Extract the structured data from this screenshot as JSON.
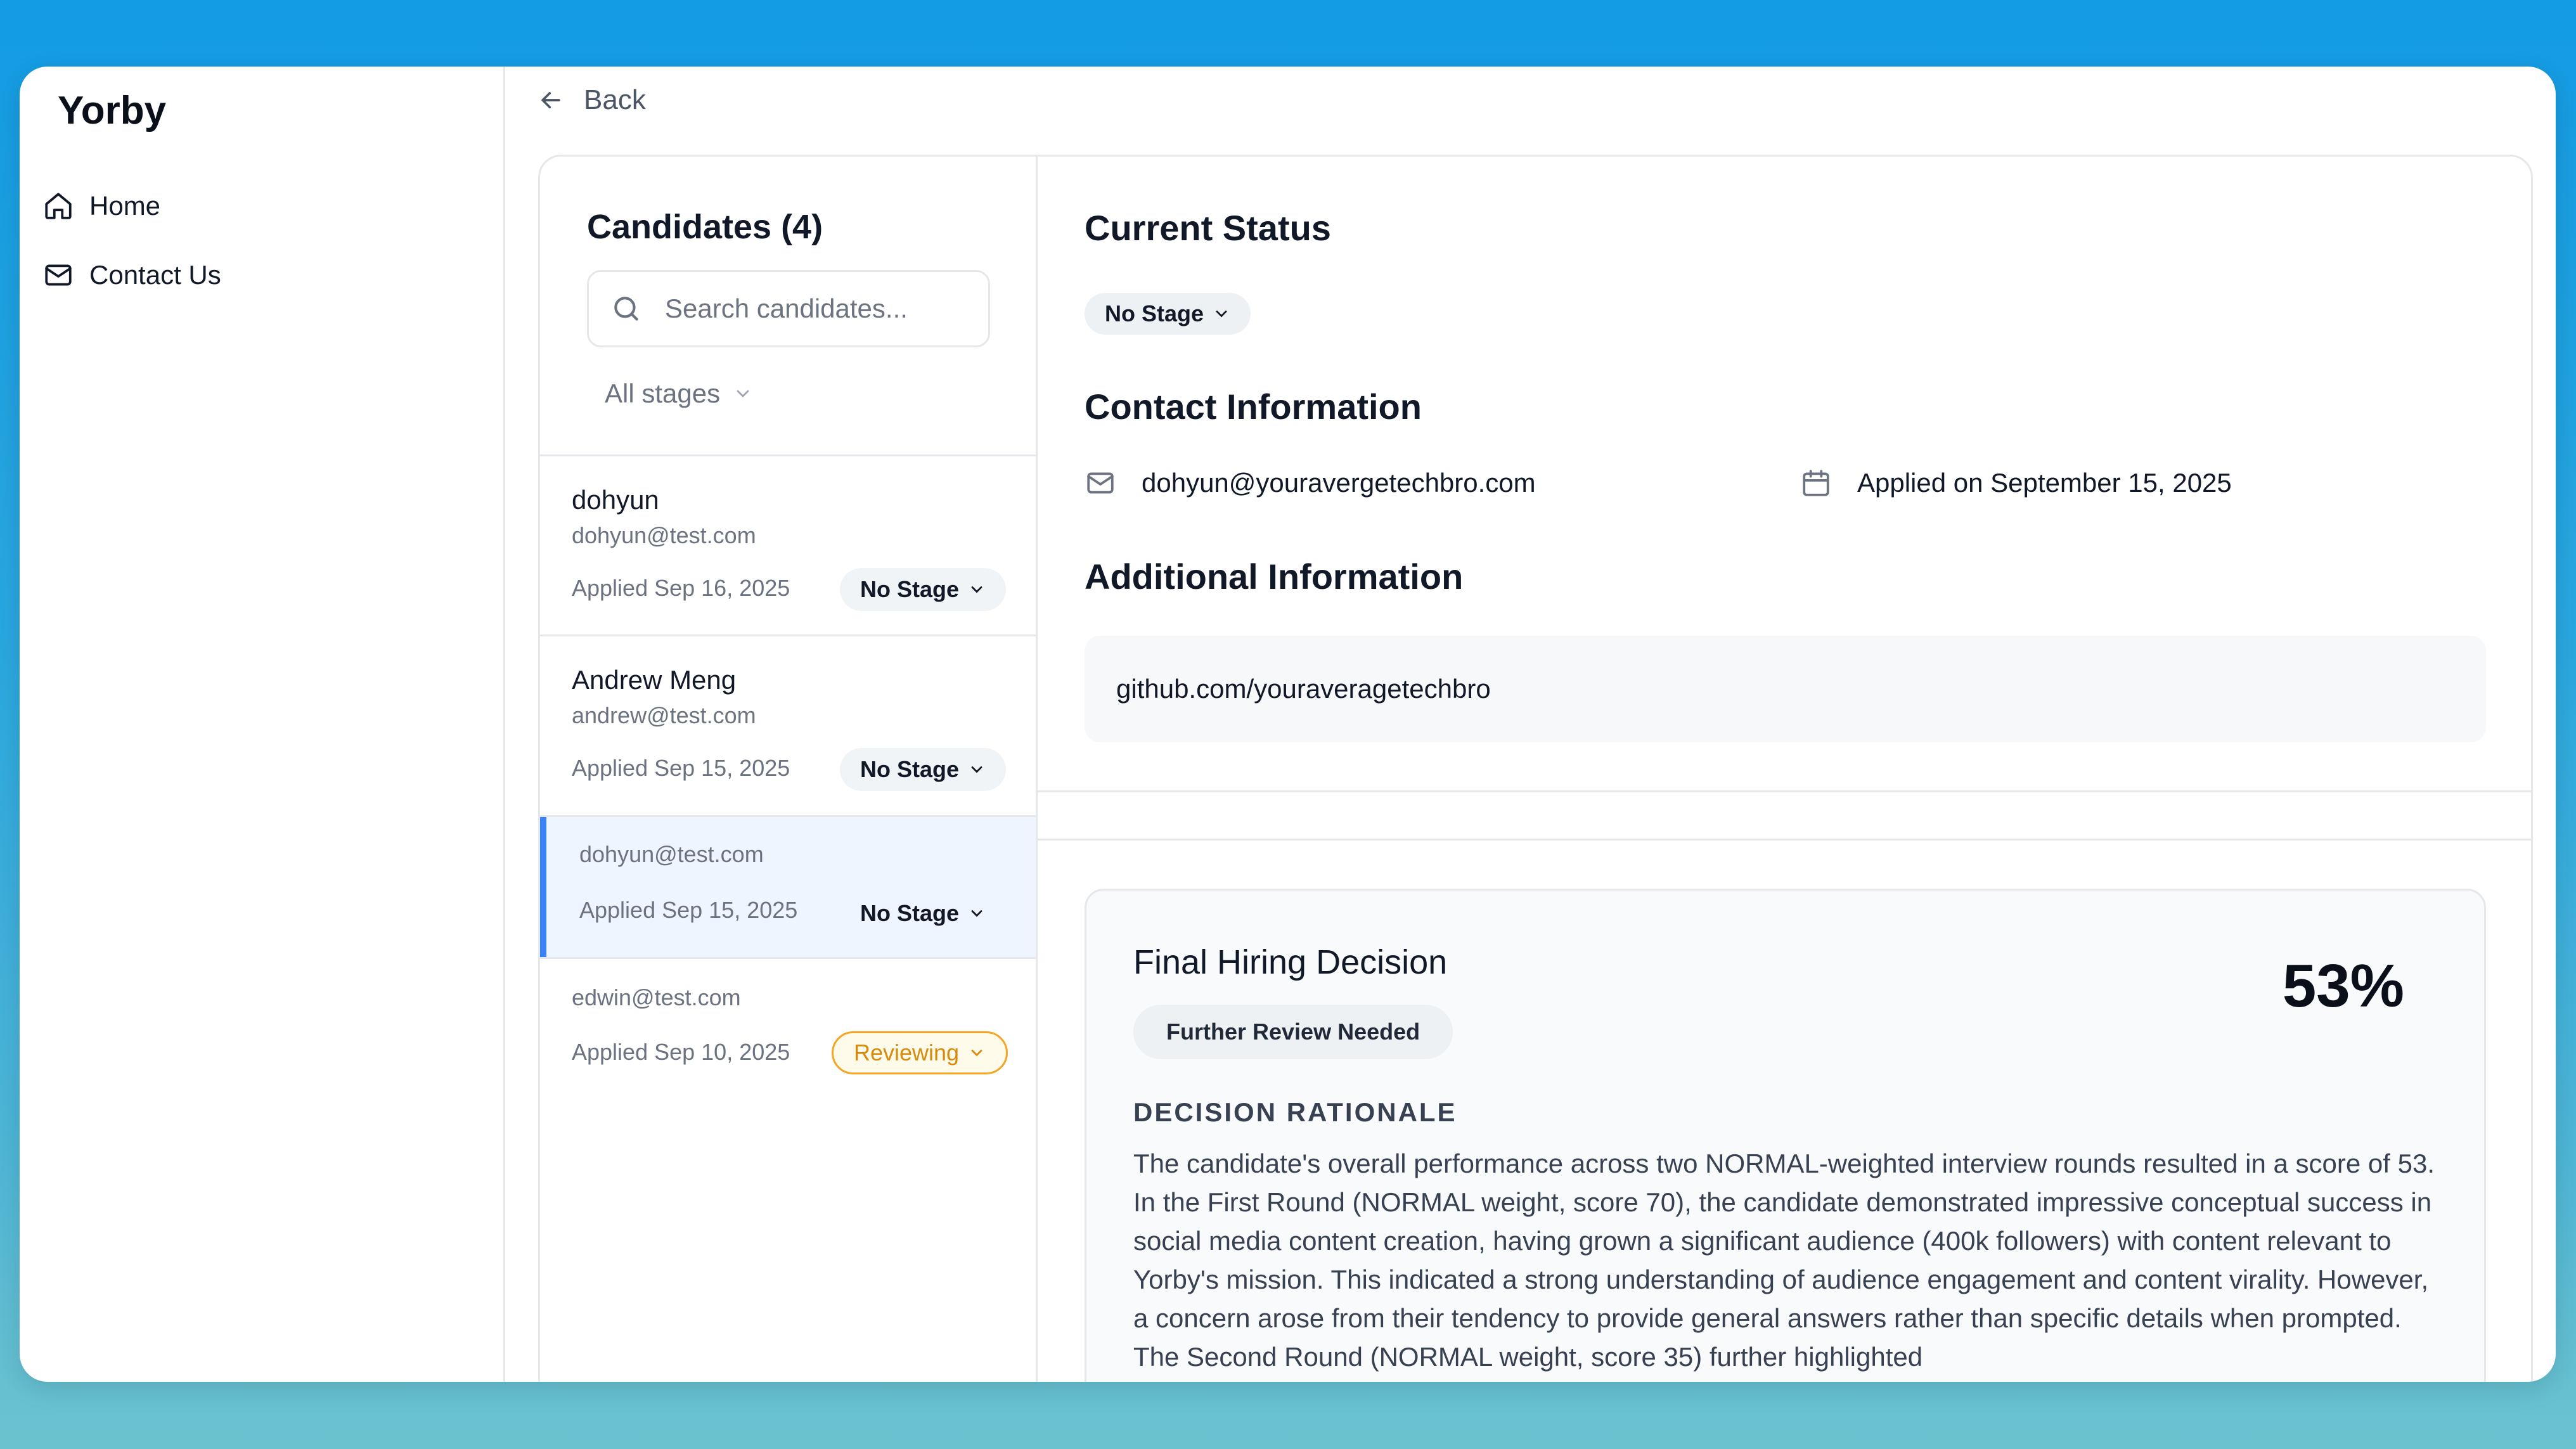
{
  "sidebar": {
    "brand": "Yorby",
    "nav": [
      {
        "label": "Home",
        "icon": "home-icon"
      },
      {
        "label": "Contact Us",
        "icon": "mail-icon"
      }
    ]
  },
  "header": {
    "back_label": "Back"
  },
  "candidates": {
    "title": "Candidates (4)",
    "search_placeholder": "Search candidates...",
    "stage_filter": "All stages",
    "items": [
      {
        "name": "dohyun",
        "email": "dohyun@test.com",
        "applied": "Applied Sep 16, 2025",
        "stage": "No Stage"
      },
      {
        "name": "Andrew Meng",
        "email": "andrew@test.com",
        "applied": "Applied Sep 15, 2025",
        "stage": "No Stage"
      },
      {
        "name": "",
        "email": "dohyun@test.com",
        "applied": "Applied Sep 15, 2025",
        "stage": "No Stage",
        "selected": true
      },
      {
        "name": "",
        "email": "edwin@test.com",
        "applied": "Applied Sep 10, 2025",
        "stage": "Reviewing"
      }
    ]
  },
  "detail": {
    "status_heading": "Current Status",
    "status_value": "No Stage",
    "contact_heading": "Contact Information",
    "email": "dohyun@youravergetechbro.com",
    "applied_on": "Applied on September 15, 2025",
    "additional_heading": "Additional Information",
    "additional_value": "github.com/youraveragetechbro",
    "decision": {
      "title": "Final Hiring Decision",
      "score": "53%",
      "badge": "Further Review Needed",
      "rationale_heading": "DECISION RATIONALE",
      "rationale": "The candidate's overall performance across two NORMAL-weighted interview rounds resulted in a score of 53. In the First Round (NORMAL weight, score 70), the candidate demonstrated impressive conceptual success in social media content creation, having grown a significant audience (400k followers) with content relevant to Yorby's mission. This indicated a strong understanding of audience engagement and content virality. However, a concern arose from their tendency to provide general answers rather than specific details when prompted. The Second Round (NORMAL weight, score 35) further highlighted"
    }
  },
  "colors": {
    "accent": "#3b82f6",
    "reviewing": "#f5a524",
    "background_top": "#139be3",
    "background_bottom": "#6cc3cf"
  }
}
